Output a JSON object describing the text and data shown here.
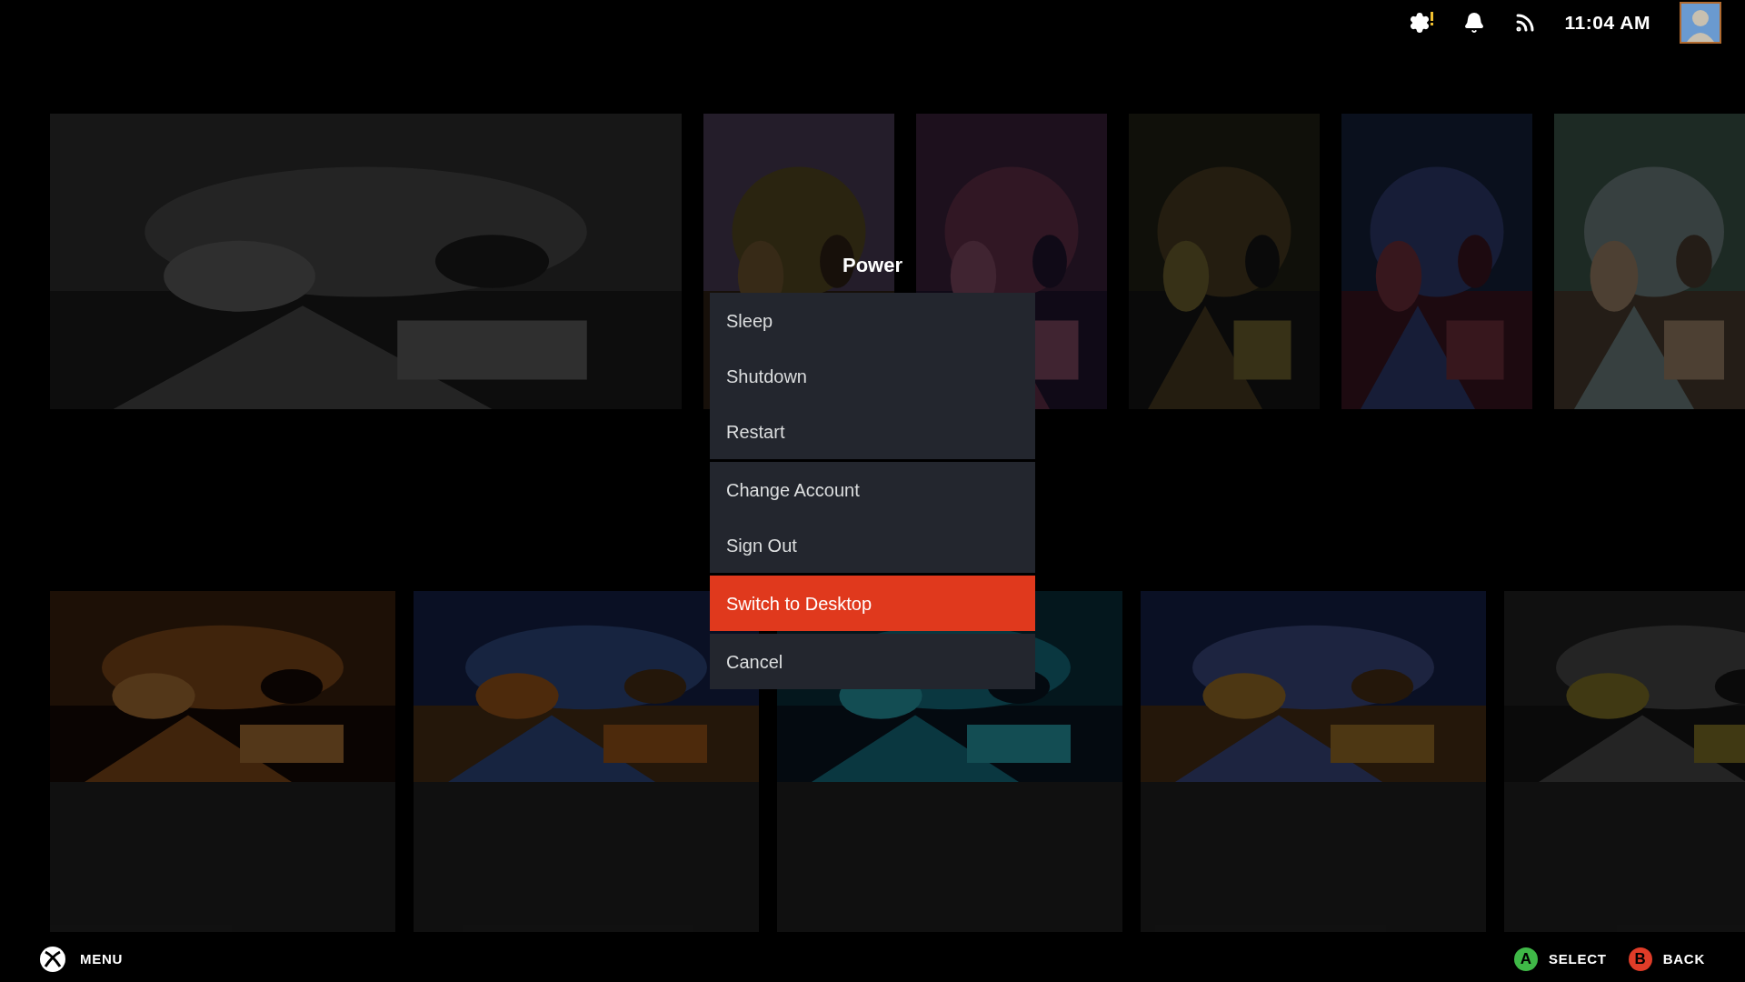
{
  "status_bar": {
    "time": "11:04 AM"
  },
  "power_menu": {
    "title": "Power",
    "groups": [
      {
        "items": [
          {
            "label": "Sleep",
            "selected": false
          },
          {
            "label": "Shutdown",
            "selected": false
          },
          {
            "label": "Restart",
            "selected": false
          }
        ]
      },
      {
        "items": [
          {
            "label": "Change Account",
            "selected": false
          },
          {
            "label": "Sign Out",
            "selected": false
          }
        ]
      },
      {
        "items": [
          {
            "label": "Switch to Desktop",
            "selected": true
          }
        ]
      },
      {
        "items": [
          {
            "label": "Cancel",
            "selected": false
          }
        ]
      }
    ]
  },
  "footer": {
    "menu_label": "MENU",
    "actions": [
      {
        "button": "A",
        "label": "SELECT",
        "color": "#3fb847"
      },
      {
        "button": "B",
        "label": "BACK",
        "color": "#e03c28"
      }
    ]
  }
}
